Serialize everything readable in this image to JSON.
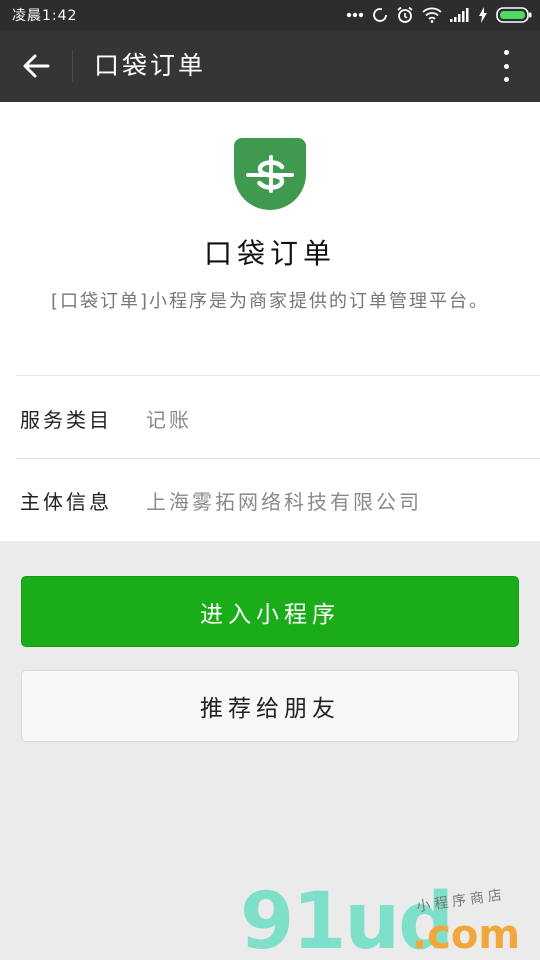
{
  "status_bar": {
    "time": "凌晨1:42"
  },
  "toolbar": {
    "title": "口袋订单"
  },
  "app": {
    "name": "口袋订单",
    "description": "[口袋订单]小程序是为商家提供的订单管理平台。",
    "logo_color": "#3f9a4f"
  },
  "info_rows": [
    {
      "label": "服务类目",
      "value": "记账"
    },
    {
      "label": "主体信息",
      "value": "上海雾拓网络科技有限公司"
    }
  ],
  "buttons": {
    "enter": "进入小程序",
    "recommend": "推荐给朋友"
  },
  "watermark": {
    "logo_text": "91ud",
    "com_text": ".com",
    "tagline": "小程序商店"
  },
  "colors": {
    "primary_green": "#1aad19",
    "toolbar_bg": "#353538",
    "status_bg": "#2d2d2f"
  }
}
